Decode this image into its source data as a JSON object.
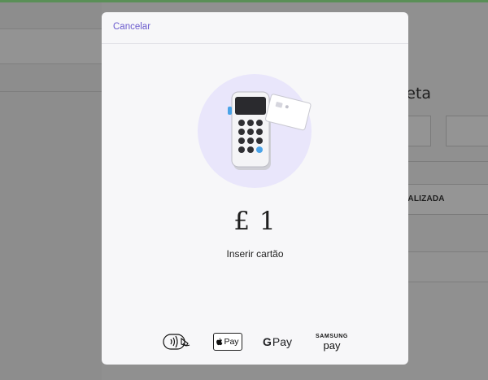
{
  "background": {
    "heading_fragment": "jeta",
    "button_fragment": "NALIZADA"
  },
  "modal": {
    "cancel_label": "Cancelar",
    "amount": "£ 1",
    "status": "Inserir cartão",
    "payment_methods": {
      "contactless_icon": "contactless-icon",
      "apple_pay": {
        "logo": "apple-logo-icon",
        "label": "Pay"
      },
      "google_pay": {
        "g": "G",
        "label": "Pay"
      },
      "samsung_pay": {
        "top": "SAMSUNG",
        "bottom": "pay"
      }
    },
    "hero_icon": "card-reader-icon"
  },
  "colors": {
    "accent": "#6a5acd",
    "hero_circle": "#e9e6fb",
    "reader_key_blue": "#4aa3e8",
    "topbar": "#5a8f57"
  }
}
